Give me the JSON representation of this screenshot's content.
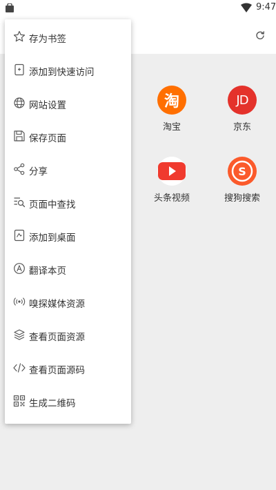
{
  "status_bar": {
    "time": "9:47"
  },
  "menu": {
    "items": [
      {
        "label": "存为书签",
        "icon": "star-icon"
      },
      {
        "label": "添加到快速访问",
        "icon": "quick-access-icon"
      },
      {
        "label": "网站设置",
        "icon": "globe-icon"
      },
      {
        "label": "保存页面",
        "icon": "save-icon"
      },
      {
        "label": "分享",
        "icon": "share-icon"
      },
      {
        "label": "页面中查找",
        "icon": "find-in-page-icon"
      },
      {
        "label": "添加到桌面",
        "icon": "add-to-desktop-icon"
      },
      {
        "label": "翻译本页",
        "icon": "translate-icon"
      },
      {
        "label": "嗅探媒体资源",
        "icon": "sniff-media-icon"
      },
      {
        "label": "查看页面资源",
        "icon": "layers-icon"
      },
      {
        "label": "查看页面源码",
        "icon": "code-icon"
      },
      {
        "label": "生成二维码",
        "icon": "qr-code-icon"
      }
    ]
  },
  "shortcuts": [
    {
      "label": "淘宝",
      "glyph": "淘",
      "color": "#ff6f00"
    },
    {
      "label": "京东",
      "glyph": "JD",
      "color": "#e4322b"
    },
    {
      "label": "头条视频",
      "glyph": "play",
      "color": "#f03a2e"
    },
    {
      "label": "搜狗搜索",
      "glyph": "S",
      "color": "#fb5a2b"
    }
  ],
  "colors": {
    "background": "#eeeeee",
    "menu_text": "#333333"
  }
}
